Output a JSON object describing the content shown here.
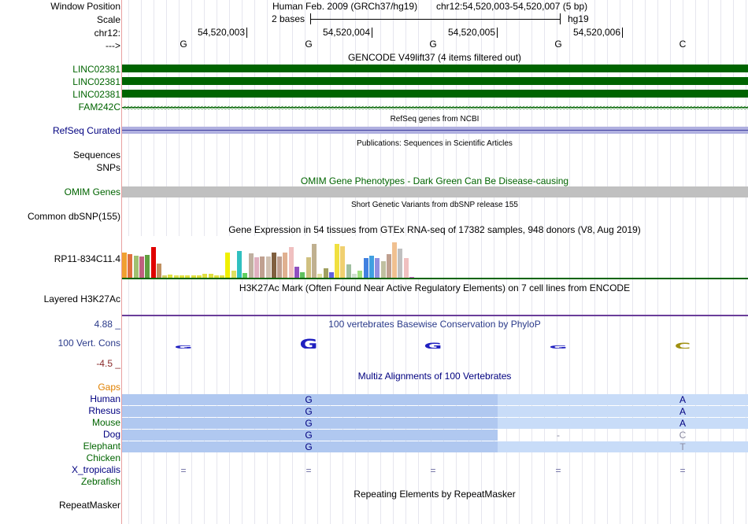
{
  "header": {
    "window_position_label": "Window Position",
    "scale_label": "Scale",
    "chrom_label": "chr12:",
    "strand_label": "--->",
    "assembly_title": "Human Feb. 2009 (GRCh37/hg19)",
    "position_text": "chr12:54,520,003-54,520,007 (5 bp)",
    "scale_text": "2 bases",
    "db_label": "hg19",
    "coordinates": [
      "54,520,003",
      "54,520,004",
      "54,520,005",
      "54,520,006"
    ],
    "bases": [
      "G",
      "G",
      "G",
      "G",
      "C"
    ]
  },
  "gencode": {
    "title": "GENCODE V49lift37 (4 items filtered out)",
    "items": [
      "LINC02381",
      "LINC02381",
      "LINC02381",
      "FAM242C"
    ],
    "color": "#006400"
  },
  "refseq": {
    "title": "RefSeq genes from NCBI",
    "label": "RefSeq Curated",
    "color": "#8080c0"
  },
  "publications": {
    "title": "Publications: Sequences in Scientific Articles",
    "label_sequences": "Sequences",
    "label_snps": "SNPs"
  },
  "omim": {
    "title": "OMIM Gene Phenotypes - Dark Green Can Be Disease-causing",
    "label": "OMIM Genes",
    "color": "#c0c0c0"
  },
  "dbsnp": {
    "title": "Short Genetic Variants from dbSNP release 155",
    "label": "Common dbSNP(155)"
  },
  "gtex": {
    "title": "Gene Expression in 54 tissues from GTEx RNA-seq of 17382 samples, 948 donors (V8, Aug 2019)",
    "label": "RP11-834C11.4",
    "bars": [
      {
        "value": 0.72,
        "color": "#f0a030"
      },
      {
        "value": 0.68,
        "color": "#e07040"
      },
      {
        "value": 0.62,
        "color": "#a0c070"
      },
      {
        "value": 0.6,
        "color": "#c06080"
      },
      {
        "value": 0.66,
        "color": "#60a040"
      },
      {
        "value": 0.86,
        "color": "#e00000"
      },
      {
        "value": 0.42,
        "color": "#c09060"
      },
      {
        "value": 0.08,
        "color": "#d0d060"
      },
      {
        "value": 0.1,
        "color": "#e0e040"
      },
      {
        "value": 0.08,
        "color": "#e0e050"
      },
      {
        "value": 0.08,
        "color": "#e0e040"
      },
      {
        "value": 0.08,
        "color": "#e0e040"
      },
      {
        "value": 0.08,
        "color": "#e0e040"
      },
      {
        "value": 0.08,
        "color": "#e0e040"
      },
      {
        "value": 0.12,
        "color": "#e0e040"
      },
      {
        "value": 0.12,
        "color": "#e0e040"
      },
      {
        "value": 0.08,
        "color": "#e0e040"
      },
      {
        "value": 0.08,
        "color": "#e0e040"
      },
      {
        "value": 0.72,
        "color": "#f0f000"
      },
      {
        "value": 0.22,
        "color": "#e0e060"
      },
      {
        "value": 0.76,
        "color": "#30c0c0"
      },
      {
        "value": 0.16,
        "color": "#60d060"
      },
      {
        "value": 0.7,
        "color": "#c0b0a0"
      },
      {
        "value": 0.58,
        "color": "#e0b0c0"
      },
      {
        "value": 0.6,
        "color": "#c0a090"
      },
      {
        "value": 0.6,
        "color": "#d0c0b0"
      },
      {
        "value": 0.72,
        "color": "#806040"
      },
      {
        "value": 0.6,
        "color": "#c0a090"
      },
      {
        "value": 0.72,
        "color": "#e0b090"
      },
      {
        "value": 0.86,
        "color": "#f0c0c0"
      },
      {
        "value": 0.32,
        "color": "#9050c0"
      },
      {
        "value": 0.18,
        "color": "#60c060"
      },
      {
        "value": 0.58,
        "color": "#d0c080"
      },
      {
        "value": 0.96,
        "color": "#c0b090"
      },
      {
        "value": 0.14,
        "color": "#e0e0a0"
      },
      {
        "value": 0.28,
        "color": "#a0a060"
      },
      {
        "value": 0.18,
        "color": "#6060e0"
      },
      {
        "value": 0.96,
        "color": "#f0e040"
      },
      {
        "value": 0.9,
        "color": "#f0d070"
      },
      {
        "value": 0.4,
        "color": "#a0c0a0"
      },
      {
        "value": 0.14,
        "color": "#d0e0d0"
      },
      {
        "value": 0.22,
        "color": "#a0e080"
      },
      {
        "value": 0.56,
        "color": "#4080e0"
      },
      {
        "value": 0.62,
        "color": "#40a0e0"
      },
      {
        "value": 0.56,
        "color": "#9090e0"
      },
      {
        "value": 0.48,
        "color": "#c0c0a0"
      },
      {
        "value": 0.68,
        "color": "#c0a090"
      },
      {
        "value": 1.0,
        "color": "#f0c090"
      },
      {
        "value": 0.82,
        "color": "#c0c0c0"
      },
      {
        "value": 0.56,
        "color": "#f0c0c0"
      },
      {
        "value": 0.04,
        "color": "#d060d0"
      }
    ]
  },
  "h3k27ac": {
    "title": "H3K27Ac Mark (Often Found Near Active Regulatory Elements) on 7 cell lines from ENCODE",
    "label": "Layered H3K27Ac"
  },
  "phylop": {
    "title": "100 vertebrates Basewise Conservation by PhyloP",
    "label": "100 Vert. Cons",
    "max_label": "4.88 _",
    "min_label": "-4.5 _",
    "letters": [
      {
        "base": "G",
        "color": "#2020c0"
      },
      {
        "base": "G",
        "color": "#2020c0"
      },
      {
        "base": "G",
        "color": "#2020c0"
      },
      {
        "base": "G",
        "color": "#2020c0"
      },
      {
        "base": "C",
        "color": "#a09010"
      }
    ]
  },
  "multiz": {
    "title": "Multiz Alignments of 100 Vertebrates",
    "gaps_label": "Gaps",
    "species": [
      {
        "name": "Human",
        "color": "#000080",
        "cells": [
          "",
          "G",
          "",
          "",
          "A"
        ]
      },
      {
        "name": "Rhesus",
        "color": "#000080",
        "cells": [
          "",
          "G",
          "",
          "",
          "A"
        ]
      },
      {
        "name": "Mouse",
        "color": "#006400",
        "cells": [
          "",
          "G",
          "",
          "",
          "A"
        ]
      },
      {
        "name": "Dog",
        "color": "#000080",
        "cells": [
          "",
          "G",
          "",
          "-",
          "C"
        ]
      },
      {
        "name": "Elephant",
        "color": "#006400",
        "cells": [
          "",
          "G",
          "",
          "",
          "T"
        ]
      },
      {
        "name": "Chicken",
        "color": "#006400",
        "cells": [
          "",
          "",
          "",
          "",
          ""
        ]
      },
      {
        "name": "X_tropicalis",
        "color": "#000080",
        "cells": [
          "=",
          "=",
          "=",
          "=",
          "="
        ]
      },
      {
        "name": "Zebrafish",
        "color": "#006400",
        "cells": [
          "",
          "",
          "",
          "",
          ""
        ]
      }
    ],
    "block_color": "#b0c8f0",
    "light_block_color": "#c8dcf8"
  },
  "repeatmasker": {
    "title": "Repeating Elements by RepeatMasker",
    "label": "RepeatMasker"
  }
}
